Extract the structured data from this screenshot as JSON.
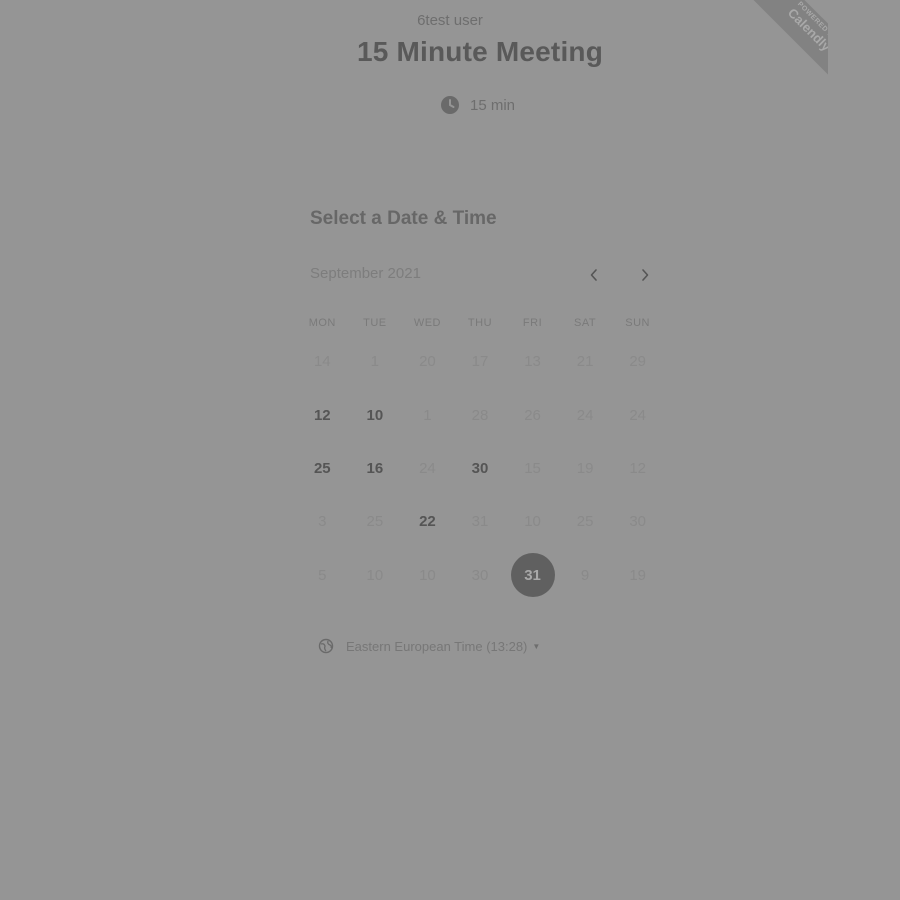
{
  "header": {
    "owner": "6test user",
    "title": "15 Minute Meeting",
    "duration": "15 min"
  },
  "ribbon": {
    "powered_by": "POWERED BY",
    "brand": "Calendly"
  },
  "scheduler": {
    "heading": "Select a Date & Time",
    "month": "September 2021",
    "prev_icon": "chevron-left-icon",
    "next_icon": "chevron-right-icon"
  },
  "calendar": {
    "weekdays": [
      "MON",
      "TUE",
      "WED",
      "THU",
      "FRI",
      "SAT",
      "SUN"
    ],
    "weeks": [
      [
        {
          "d": "14",
          "s": "off"
        },
        {
          "d": "1",
          "s": "off"
        },
        {
          "d": "20",
          "s": "off"
        },
        {
          "d": "17",
          "s": "off"
        },
        {
          "d": "13",
          "s": "off"
        },
        {
          "d": "21",
          "s": "off"
        },
        {
          "d": "29",
          "s": "off"
        }
      ],
      [
        {
          "d": "12",
          "s": "available"
        },
        {
          "d": "10",
          "s": "available"
        },
        {
          "d": "1",
          "s": "off"
        },
        {
          "d": "28",
          "s": "off"
        },
        {
          "d": "26",
          "s": "off"
        },
        {
          "d": "24",
          "s": "off"
        },
        {
          "d": "24",
          "s": "off"
        }
      ],
      [
        {
          "d": "25",
          "s": "available"
        },
        {
          "d": "16",
          "s": "available"
        },
        {
          "d": "24",
          "s": "off"
        },
        {
          "d": "30",
          "s": "available"
        },
        {
          "d": "15",
          "s": "off"
        },
        {
          "d": "19",
          "s": "off"
        },
        {
          "d": "12",
          "s": "off"
        }
      ],
      [
        {
          "d": "3",
          "s": "off"
        },
        {
          "d": "25",
          "s": "off"
        },
        {
          "d": "22",
          "s": "available"
        },
        {
          "d": "31",
          "s": "off"
        },
        {
          "d": "10",
          "s": "off"
        },
        {
          "d": "25",
          "s": "off"
        },
        {
          "d": "30",
          "s": "off"
        }
      ],
      [
        {
          "d": "5",
          "s": "off"
        },
        {
          "d": "10",
          "s": "off"
        },
        {
          "d": "10",
          "s": "off"
        },
        {
          "d": "30",
          "s": "off"
        },
        {
          "d": "31",
          "s": "selected"
        },
        {
          "d": "9",
          "s": "off"
        },
        {
          "d": "19",
          "s": "off"
        }
      ]
    ]
  },
  "timezone": {
    "label": "Eastern European Time (13:28)",
    "icon": "globe-icon"
  },
  "colors": {
    "background": "#959595",
    "selected_day": "#606060"
  }
}
